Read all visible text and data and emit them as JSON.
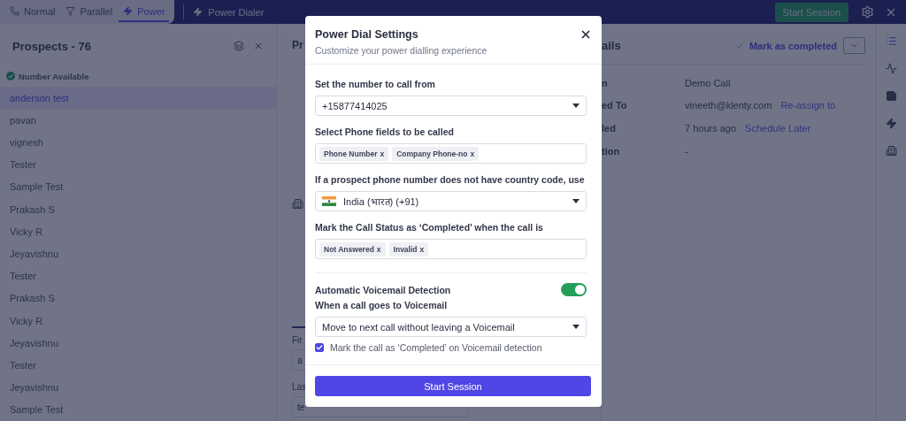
{
  "top_bar": {
    "modes": [
      {
        "kind": "phone",
        "label": "Normal",
        "selected": false
      },
      {
        "kind": "filter",
        "label": "Parallel",
        "selected": false
      },
      {
        "kind": "bolt",
        "label": "Power",
        "selected": true
      }
    ],
    "title": "Power Dialer",
    "start_button": "Start Session"
  },
  "prospects": {
    "title": "Prospects - 76",
    "section": "Number Available",
    "items": [
      {
        "name": "anderson test",
        "selected": true
      },
      {
        "name": "pavan",
        "selected": false
      },
      {
        "name": "vignesh",
        "selected": false
      },
      {
        "name": "Tester",
        "selected": false
      },
      {
        "name": "Sample Test",
        "selected": false
      },
      {
        "name": "Prakash S",
        "selected": false
      },
      {
        "name": "Vicky R",
        "selected": false
      },
      {
        "name": "Jeyavishnu",
        "selected": false
      },
      {
        "name": "Tester",
        "selected": false
      },
      {
        "name": "Prakash S",
        "selected": false
      },
      {
        "name": "Vicky R",
        "selected": false
      },
      {
        "name": "Jeyavishnu",
        "selected": false
      },
      {
        "name": "Tester",
        "selected": false
      },
      {
        "name": "Jeyavishnu",
        "selected": false
      },
      {
        "name": "Sample Test",
        "selected": false
      }
    ]
  },
  "record_panel": {
    "title": "Pr",
    "fields": [
      {
        "label": "Fir",
        "value": "a"
      },
      {
        "label": "Las",
        "value": "te"
      }
    ]
  },
  "details": {
    "title": "ails",
    "action": "Mark as completed",
    "rows": [
      {
        "label": "n",
        "value": "Demo Call"
      },
      {
        "label": "ed To",
        "value": "vineeth@klenty.com",
        "link": "Re-assign to"
      },
      {
        "label": "led",
        "value": "7 hours ago",
        "link": "Schedule Later"
      },
      {
        "label": "tion",
        "value": "-"
      }
    ]
  },
  "modal": {
    "title": "Power Dial Settings",
    "subtitle": "Customize your power dialling experience",
    "fields": [
      {
        "kind": "select",
        "label": "Set the number to call from",
        "value": "+15877414025"
      },
      {
        "kind": "tags",
        "label": "Select Phone fields to be called",
        "tags": [
          {
            "label": "Phone Number",
            "remove": "x"
          },
          {
            "label": "Company Phone-no",
            "remove": "x"
          }
        ]
      },
      {
        "kind": "country",
        "label": "If a prospect phone number does not have country code, use",
        "value": "India (भारत) (+91)"
      },
      {
        "kind": "tags",
        "label": "Mark the Call Status as ‘Completed’ when the call is",
        "tags": [
          {
            "label": "Not Answered",
            "remove": "x"
          },
          {
            "label": "Invalid",
            "remove": "x"
          }
        ]
      }
    ],
    "voicemail": {
      "label": "Automatic Voicemail Detection",
      "on": true,
      "select_label": "When a call goes to Voicemail",
      "select_value": "Move to next call without leaving a Voicemail",
      "checkbox_label": "Mark the call as ‘Completed’ on Voicemail detection",
      "checked": true
    },
    "submit": "Start Session"
  }
}
